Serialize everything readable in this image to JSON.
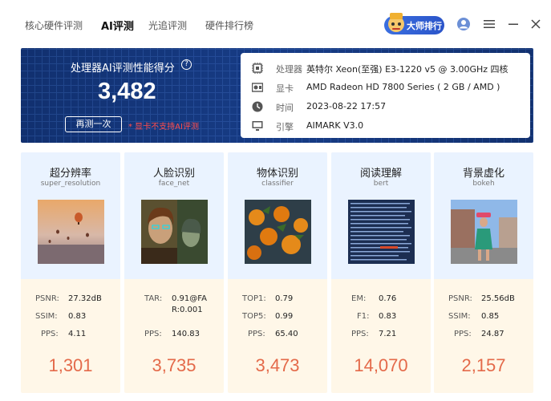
{
  "nav": {
    "tabs": [
      "核心硬件评测",
      "AI评测",
      "光追评测",
      "硬件排行榜"
    ],
    "active_tab": "AI评测",
    "rank_button": "大师排行"
  },
  "score_panel": {
    "title": "处理器AI评测性能得分",
    "score": "3,482",
    "retest_button": "再测一次",
    "warning": "* 显卡不支持AI评测"
  },
  "system_info": [
    {
      "icon": "cpu-icon",
      "key": "处理器",
      "value": "英特尔 Xeon(至强) E3-1220 v5 @ 3.00GHz 四核"
    },
    {
      "icon": "gpu-icon",
      "key": "显卡",
      "value": "AMD Radeon HD 7800 Series ( 2 GB / AMD )"
    },
    {
      "icon": "clock-icon",
      "key": "时间",
      "value": "2023-08-22 17:57"
    },
    {
      "icon": "monitor-icon",
      "key": "引擎",
      "value": "AIMARK V3.0"
    }
  ],
  "cards": [
    {
      "name": "超分辨率",
      "sub": "super_resolution",
      "image": "balloons-image",
      "metrics": [
        {
          "k": "PSNR:",
          "v": "27.32dB"
        },
        {
          "k": "SSIM:",
          "v": "0.83"
        },
        {
          "k": "PPS:",
          "v": "4.11"
        }
      ],
      "score": "1,301"
    },
    {
      "name": "人脸识别",
      "sub": "face_net",
      "image": "faces-image",
      "metrics": [
        {
          "k": "TAR:",
          "v": "0.91@FA"
        },
        {
          "k": "",
          "v": "R:0.001"
        },
        {
          "k": "PPS:",
          "v": "140.83"
        }
      ],
      "score": "3,735"
    },
    {
      "name": "物体识别",
      "sub": "classifier",
      "image": "oranges-image",
      "metrics": [
        {
          "k": "TOP1:",
          "v": "0.79"
        },
        {
          "k": "TOP5:",
          "v": "0.99"
        },
        {
          "k": "PPS:",
          "v": "65.40"
        }
      ],
      "score": "3,473"
    },
    {
      "name": "阅读理解",
      "sub": "bert",
      "image": "text-image",
      "metrics": [
        {
          "k": "EM:",
          "v": "0.76"
        },
        {
          "k": "F1:",
          "v": "0.83"
        },
        {
          "k": "PPS:",
          "v": "7.21"
        }
      ],
      "score": "14,070"
    },
    {
      "name": "背景虚化",
      "sub": "bokeh",
      "image": "street-image",
      "metrics": [
        {
          "k": "PSNR:",
          "v": "25.56dB"
        },
        {
          "k": "SSIM:",
          "v": "0.85"
        },
        {
          "k": "PPS:",
          "v": "24.87"
        }
      ],
      "score": "2,157"
    }
  ],
  "colors": {
    "panel_bg": "#173c86",
    "score_accent": "#e46a4a",
    "warning": "#ff4d4d",
    "card_top": "#eaf3ff",
    "card_bottom": "#fff7e8"
  }
}
